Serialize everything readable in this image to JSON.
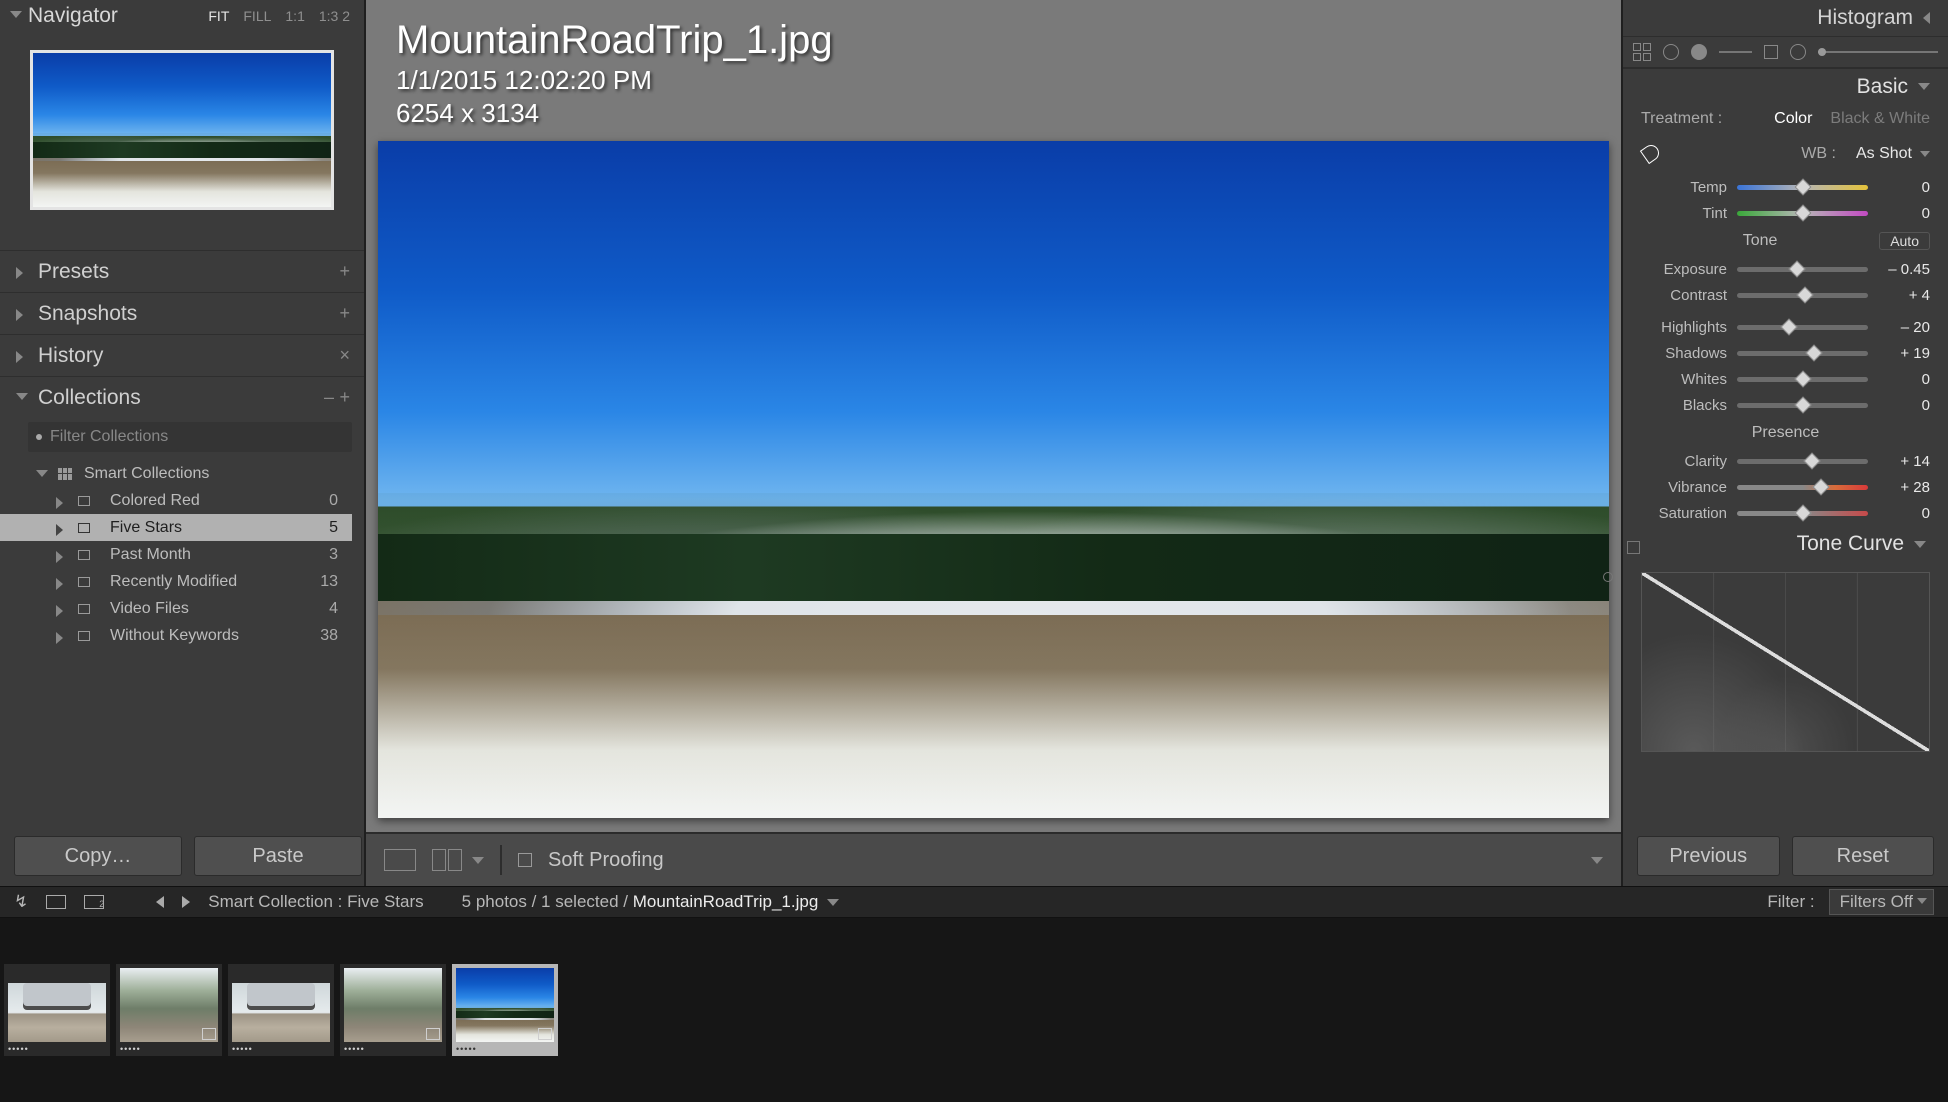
{
  "navigator": {
    "title": "Navigator",
    "modes": {
      "fit": "FIT",
      "fill": "FILL",
      "one": "1:1",
      "ratio": "1:3 2"
    }
  },
  "sections": {
    "presets": "Presets",
    "snapshots": "Snapshots",
    "history": "History",
    "collections": "Collections",
    "filter_placeholder": "Filter Collections"
  },
  "smart": {
    "title": "Smart Collections",
    "items": [
      {
        "label": "Colored Red",
        "count": "0"
      },
      {
        "label": "Five Stars",
        "count": "5",
        "selected": true
      },
      {
        "label": "Past Month",
        "count": "3"
      },
      {
        "label": "Recently Modified",
        "count": "13"
      },
      {
        "label": "Video Files",
        "count": "4"
      },
      {
        "label": "Without Keywords",
        "count": "38"
      }
    ]
  },
  "info": {
    "filename": "MountainRoadTrip_1.jpg",
    "datetime": "1/1/2015 12:02:20 PM",
    "dimensions": "6254 x 3134"
  },
  "center_toolbar": {
    "soft_proof": "Soft Proofing"
  },
  "buttons": {
    "copy": "Copy…",
    "paste": "Paste",
    "previous": "Previous",
    "reset": "Reset"
  },
  "right": {
    "histogram": "Histogram",
    "basic": "Basic",
    "treatment_label": "Treatment :",
    "treatment_color": "Color",
    "treatment_bw": "Black & White",
    "wb_label": "WB :",
    "wb_value": "As Shot",
    "tone": "Tone",
    "auto": "Auto",
    "presence": "Presence",
    "tone_curve": "Tone Curve",
    "sliders": {
      "temp": {
        "label": "Temp",
        "value": "0",
        "pos": 50
      },
      "tint": {
        "label": "Tint",
        "value": "0",
        "pos": 50
      },
      "exp": {
        "label": "Exposure",
        "value": "– 0.45",
        "pos": 46
      },
      "con": {
        "label": "Contrast",
        "value": "+ 4",
        "pos": 52
      },
      "hi": {
        "label": "Highlights",
        "value": "– 20",
        "pos": 40
      },
      "sh": {
        "label": "Shadows",
        "value": "+ 19",
        "pos": 59
      },
      "wh": {
        "label": "Whites",
        "value": "0",
        "pos": 50
      },
      "bl": {
        "label": "Blacks",
        "value": "0",
        "pos": 50
      },
      "cl": {
        "label": "Clarity",
        "value": "+ 14",
        "pos": 57
      },
      "vi": {
        "label": "Vibrance",
        "value": "+ 28",
        "pos": 64
      },
      "sa": {
        "label": "Saturation",
        "value": "0",
        "pos": 50
      }
    }
  },
  "status": {
    "breadcrumb_a": "Smart Collection : Five Stars",
    "counts": "5 photos / 1 selected /",
    "filename": "MountainRoadTrip_1.jpg",
    "filter_label": "Filter :",
    "filter_value": "Filters Off"
  },
  "filmstrip": [
    {
      "type": "car",
      "stars": "•••••"
    },
    {
      "type": "road",
      "stars": "•••••",
      "badge": true
    },
    {
      "type": "car",
      "stars": "•••••"
    },
    {
      "type": "road",
      "stars": "•••••",
      "badge": true
    },
    {
      "type": "landscape",
      "stars": "•••••",
      "badge": true,
      "selected": true
    }
  ]
}
